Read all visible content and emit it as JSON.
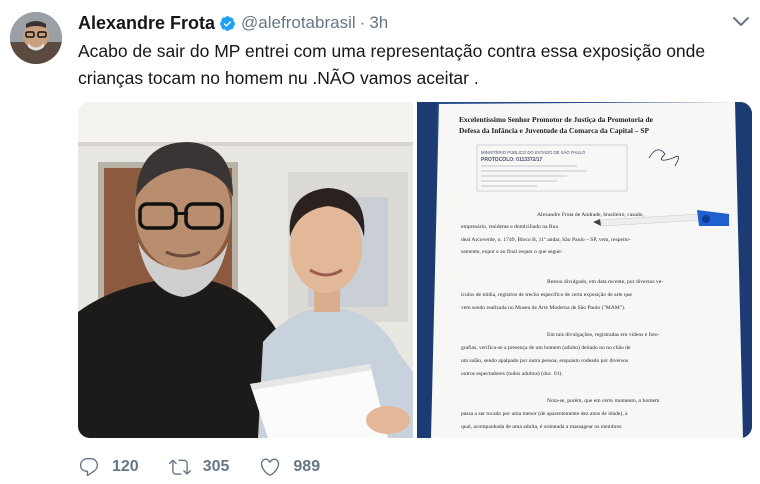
{
  "tweet": {
    "author_name": "Alexandre Frota",
    "handle": "@alefrotabrasil",
    "separator": "·",
    "time": "3h",
    "text": "Acabo de sair do MP entrei com uma representação contra essa exposição onde crianças tocam no homem nu .NÃO vamos aceitar ."
  },
  "document": {
    "heading_line1": "Excelentíssimo Senhor Promotor de Justiça da Promotoria de",
    "heading_line2": "Defesa da Infância e Juventude da Comarca da Capital – SP",
    "stamp_line1": "MINISTÉRIO PÚBLICO DO ESTADO DE SÃO PAULO",
    "stamp_line2": "PROTOCOLO: 0113372/17",
    "body_line1": "Alexandre Frota de Andrade, brasileiro, casado,",
    "body_line2": "empresário, residente e domiciliado na Rua",
    "body_line3": "deal Arcoverde, n. 1749, Bloco B, 11º andar, São Paulo – SP, vem, respeito-",
    "body_line4": "samente, expor e ao final requer o que segue:",
    "body_line5": "Restou divulgado, em data recente, por diversos ve-",
    "body_line6": "ículos de mídia, registros de trecho específico de certa exposição de arte que",
    "body_line7": "vem sendo realizada no Museu de Arte Moderna de São Paulo (\"MAM\").",
    "body_line8": "Em tais divulgações, registradas em vídeos e foto-",
    "body_line9": "grafias, verifica-se a presença de um homem (adulto) deitado no no chão de",
    "body_line10": "um salão, sendo apalpado por outra pessoa, enquanto rodeado por diversos",
    "body_line11": "outros espectadores (todos adultos) (doc. 01).",
    "body_line12": "Nota-se, porém, que em certo momento, o homem",
    "body_line13": "passa a ser tocado por uma menor (de aparentemente dez anos de idade), a",
    "body_line14": "qual, acompanhada de uma adulta, é orientada a massagear os membros"
  },
  "actions": {
    "replies": "120",
    "retweets": "305",
    "likes": "989"
  },
  "colors": {
    "verified": "#1da1f2",
    "muted": "#657786",
    "text": "#14171a"
  },
  "icons": [
    "verified-badge-icon",
    "chevron-down-icon",
    "reply-icon",
    "retweet-icon",
    "like-icon"
  ]
}
